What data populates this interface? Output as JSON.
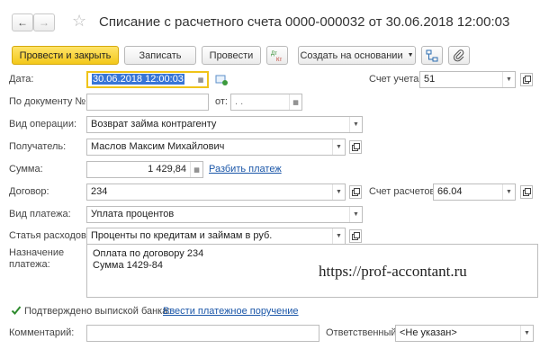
{
  "header": {
    "title": "Списание с расчетного счета 0000-000032 от 30.06.2018 12:00:03"
  },
  "toolbar": {
    "post_close_label": "Провести и закрыть",
    "save_label": "Записать",
    "post_label": "Провести",
    "dtkt_label": "Дт Кт",
    "create_basis_label": "Создать на основании"
  },
  "form": {
    "date_label": "Дата:",
    "date_value": "30.06.2018 12:00:03",
    "account_label": "Счет учета:",
    "account_value": "51",
    "doc_number_label": "По документу №:",
    "doc_from_label": "от:",
    "doc_from_value": ". .",
    "operation_label": "Вид операции:",
    "operation_value": "Возврат займа контрагенту",
    "recipient_label": "Получатель:",
    "recipient_value": "Маслов Максим Михайлович",
    "amount_label": "Сумма:",
    "amount_value": "1 429,84",
    "split_payment_link": "Разбить платеж",
    "contract_label": "Договор:",
    "contract_value": "234",
    "settlement_account_label": "Счет расчетов:",
    "settlement_account_value": "66.04",
    "payment_type_label": "Вид платежа:",
    "payment_type_value": "Уплата процентов",
    "expense_item_label": "Статья расходов:",
    "expense_item_value": "Проценты по кредитам и займам в руб.",
    "purpose_label_line1": "Назначение",
    "purpose_label_line2": "платежа:",
    "purpose_line1": "Оплата по договору 234",
    "purpose_line2": "Сумма 1429-84",
    "confirmed_label": "Подтверждено выпиской банка:",
    "confirmed_checked": true,
    "enter_order_link": "Ввести платежное поручение",
    "comment_label": "Комментарий:",
    "responsible_label": "Ответственный:",
    "responsible_value": "<Не указан>"
  },
  "watermark": "https://prof-accontant.ru",
  "colors": {
    "primary_button": "#f3c81a",
    "link": "#1a56a8",
    "checkbox": "#2e8b2e"
  }
}
